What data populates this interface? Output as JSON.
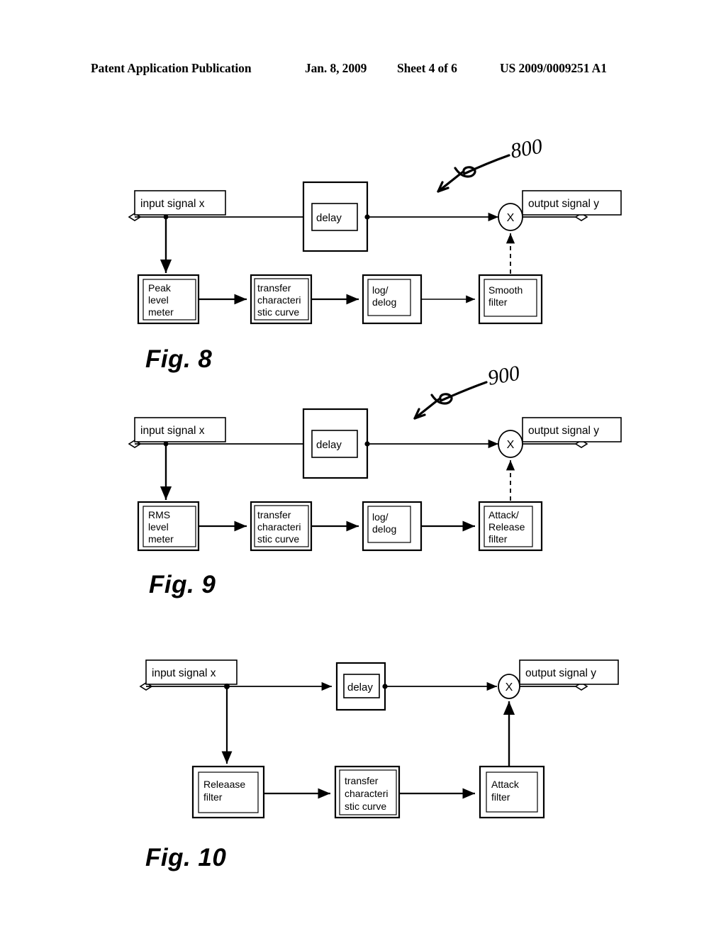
{
  "header": {
    "publication": "Patent Application Publication",
    "date": "Jan. 8, 2009",
    "sheet": "Sheet 4 of 6",
    "patent_number": "US 2009/0009251 A1"
  },
  "figures": [
    {
      "caption": "Fig. 8",
      "reference_numeral": "800",
      "input_label": "input signal x",
      "output_label": "output signal y",
      "delay_label": "delay",
      "multiplier_label": "X",
      "chain": [
        {
          "line1": "Peak",
          "line2": "level",
          "line3": "meter"
        },
        {
          "line1": "transfer",
          "line2": "characteri",
          "line3": "stic curve"
        },
        {
          "line1": "log/",
          "line2": "delog",
          "line3": ""
        },
        {
          "line1": "Smooth",
          "line2": "filter",
          "line3": ""
        }
      ],
      "control_link_style": "dashed"
    },
    {
      "caption": "Fig. 9",
      "reference_numeral": "900",
      "input_label": "input signal x",
      "output_label": "output signal y",
      "delay_label": "delay",
      "multiplier_label": "X",
      "chain": [
        {
          "line1": "RMS",
          "line2": "level",
          "line3": "meter"
        },
        {
          "line1": "transfer",
          "line2": "characteri",
          "line3": "stic curve"
        },
        {
          "line1": "log/",
          "line2": "delog",
          "line3": ""
        },
        {
          "line1": "Attack/",
          "line2": "Release",
          "line3": "filter"
        }
      ],
      "control_link_style": "dashed"
    },
    {
      "caption": "Fig. 10",
      "reference_numeral": "",
      "input_label": "input signal x",
      "output_label": "output signal y",
      "delay_label": "delay",
      "multiplier_label": "X",
      "chain": [
        {
          "line1": "Releaase",
          "line2": "filter",
          "line3": ""
        },
        {
          "line1": "transfer",
          "line2": "characteri",
          "line3": "stic curve"
        },
        {
          "line1": "Attack",
          "line2": "filter",
          "line3": ""
        }
      ],
      "control_link_style": "solid"
    }
  ],
  "colors": {
    "ink": "#000000",
    "paper": "#ffffff"
  }
}
